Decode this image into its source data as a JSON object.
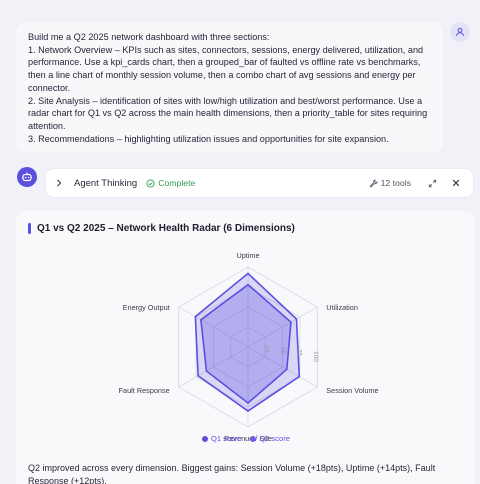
{
  "user_message": {
    "lines": [
      "Build me a Q2 2025 network dashboard with three sections:",
      "1. Network Overview – KPIs such as sites, connectors, sessions, energy delivered, utilization, and performance. Use a kpi_cards chart, then a grouped_bar of faulted vs offline rate vs benchmarks, then a line chart of monthly session volume, then a combo chart of avg sessions and energy per connector.",
      "2. Site Analysis – identification of sites with low/high utilization and best/worst performance. Use a radar chart for Q1 vs Q2 across the main health dimensions, then a priority_table for sites requiring attention.",
      "3. Recommendations – highlighting utilization issues and opportunities for site expansion."
    ]
  },
  "icons": {
    "user_avatar": "user-icon",
    "agent_avatar": "robot-icon",
    "expand": "chevron-right-icon",
    "status": "check-circle-icon",
    "tools": "wrench-icon",
    "maximize": "expand-arrows-icon",
    "close": "close-icon"
  },
  "thinking": {
    "title": "Agent Thinking",
    "status": "Complete",
    "tools": "12 tools"
  },
  "colors": {
    "accent": "#5b4fe0",
    "complete": "#2f9e58",
    "q1_fill": "rgba(91,79,224,0.35)",
    "q2_fill": "rgba(91,79,224,0.22)"
  },
  "chart_data": {
    "type": "radar",
    "title": "Q1 vs Q2 2025 – Network Health Radar (6 Dimensions)",
    "axes": [
      "Uptime",
      "Utilization",
      "Session Volume",
      "Revenue / Site",
      "Fault Response",
      "Energy Output"
    ],
    "range": [
      0,
      100
    ],
    "ticks": [
      25,
      50,
      75,
      100
    ],
    "series": [
      {
        "name": "Q1 score",
        "values": [
          78,
          62,
          56,
          70,
          60,
          68
        ]
      },
      {
        "name": "Q2 score",
        "values": [
          92,
          70,
          74,
          80,
          72,
          76
        ]
      }
    ],
    "legend": "bottom"
  },
  "summary": "Q2 improved across every dimension. Biggest gains: Session Volume (+18pts), Uptime (+14pts), Fault Response (+12pts)."
}
